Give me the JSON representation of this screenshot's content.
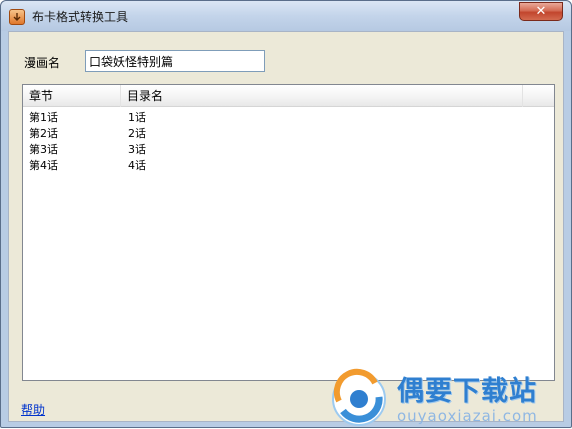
{
  "window": {
    "title": "布卡格式转换工具",
    "close_label": "✕"
  },
  "form": {
    "manga_name_label": "漫画名",
    "manga_name_value": "口袋妖怪特别篇"
  },
  "list": {
    "columns": [
      "章节",
      "目录名"
    ],
    "rows": [
      {
        "chapter": "第1话",
        "dir": "1话"
      },
      {
        "chapter": "第2话",
        "dir": "2话"
      },
      {
        "chapter": "第3话",
        "dir": "3话"
      },
      {
        "chapter": "第4话",
        "dir": "4话"
      }
    ]
  },
  "footer": {
    "help_label": "帮助"
  },
  "watermark": {
    "text": "偶要下载站",
    "url": "ouyaoxiazai.com"
  },
  "colors": {
    "accent": "#2f7fd0",
    "close": "#c2452d",
    "link": "#0033cc"
  }
}
